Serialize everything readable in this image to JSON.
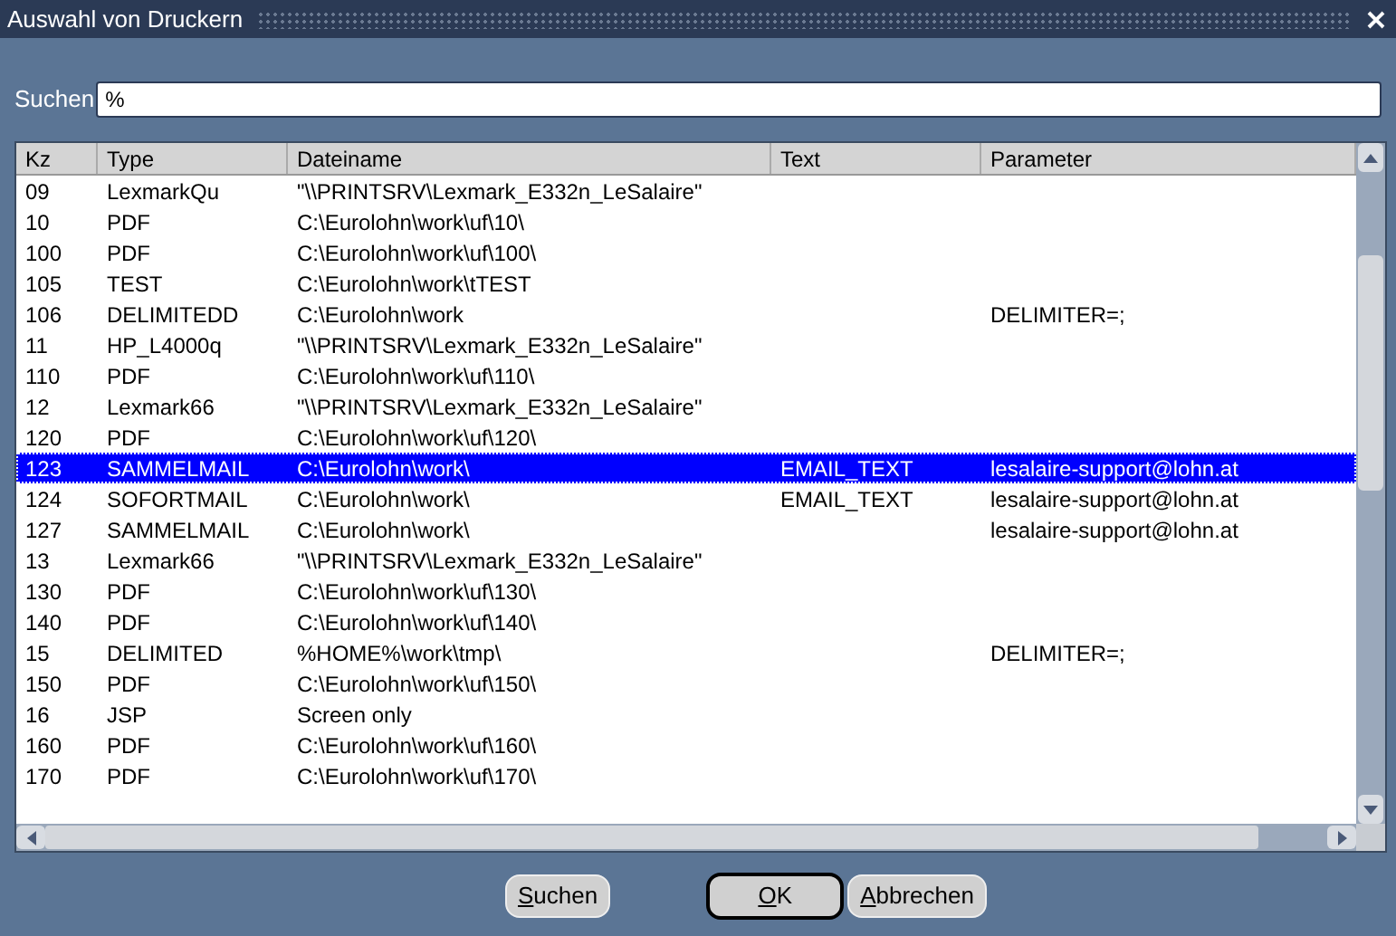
{
  "window": {
    "title": "Auswahl von Druckern"
  },
  "search": {
    "label": "Suchen",
    "value": "%"
  },
  "table": {
    "columns": [
      "Kz",
      "Type",
      "Dateiname",
      "Text",
      "Parameter"
    ],
    "rows": [
      {
        "cells": [
          "09",
          "LexmarkQu",
          "\"\\\\PRINTSRV\\Lexmark_E332n_LeSalaire\"",
          "",
          ""
        ],
        "selected": false
      },
      {
        "cells": [
          "10",
          "PDF",
          "C:\\Eurolohn\\work\\uf\\10\\",
          "",
          ""
        ],
        "selected": false
      },
      {
        "cells": [
          "100",
          "PDF",
          "C:\\Eurolohn\\work\\uf\\100\\",
          "",
          ""
        ],
        "selected": false
      },
      {
        "cells": [
          "105",
          "TEST",
          "C:\\Eurolohn\\work\\tTEST",
          "",
          ""
        ],
        "selected": false
      },
      {
        "cells": [
          "106",
          "DELIMITEDD",
          "C:\\Eurolohn\\work",
          "",
          "DELIMITER=;"
        ],
        "selected": false
      },
      {
        "cells": [
          "11",
          "HP_L4000q",
          "\"\\\\PRINTSRV\\Lexmark_E332n_LeSalaire\"",
          "",
          ""
        ],
        "selected": false
      },
      {
        "cells": [
          "110",
          "PDF",
          "C:\\Eurolohn\\work\\uf\\110\\",
          "",
          ""
        ],
        "selected": false
      },
      {
        "cells": [
          "12",
          "Lexmark66",
          "\"\\\\PRINTSRV\\Lexmark_E332n_LeSalaire\"",
          "",
          ""
        ],
        "selected": false
      },
      {
        "cells": [
          "120",
          "PDF",
          "C:\\Eurolohn\\work\\uf\\120\\",
          "",
          ""
        ],
        "selected": false
      },
      {
        "cells": [
          "123",
          "SAMMELMAIL",
          "C:\\Eurolohn\\work\\",
          "EMAIL_TEXT",
          "lesalaire-support@lohn.at"
        ],
        "selected": true
      },
      {
        "cells": [
          "124",
          "SOFORTMAIL",
          "C:\\Eurolohn\\work\\",
          "EMAIL_TEXT",
          "lesalaire-support@lohn.at"
        ],
        "selected": false
      },
      {
        "cells": [
          "127",
          "SAMMELMAIL",
          "C:\\Eurolohn\\work\\",
          "",
          "lesalaire-support@lohn.at"
        ],
        "selected": false
      },
      {
        "cells": [
          "13",
          "Lexmark66",
          "\"\\\\PRINTSRV\\Lexmark_E332n_LeSalaire\"",
          "",
          ""
        ],
        "selected": false
      },
      {
        "cells": [
          "130",
          "PDF",
          "C:\\Eurolohn\\work\\uf\\130\\",
          "",
          ""
        ],
        "selected": false
      },
      {
        "cells": [
          "140",
          "PDF",
          "C:\\Eurolohn\\work\\uf\\140\\",
          "",
          ""
        ],
        "selected": false
      },
      {
        "cells": [
          "15",
          "DELIMITED",
          "%HOME%\\work\\tmp\\",
          "",
          "DELIMITER=;"
        ],
        "selected": false
      },
      {
        "cells": [
          "150",
          "PDF",
          "C:\\Eurolohn\\work\\uf\\150\\",
          "",
          ""
        ],
        "selected": false
      },
      {
        "cells": [
          "16",
          "JSP",
          "Screen only",
          "",
          ""
        ],
        "selected": false
      },
      {
        "cells": [
          "160",
          "PDF",
          "C:\\Eurolohn\\work\\uf\\160\\",
          "",
          ""
        ],
        "selected": false
      },
      {
        "cells": [
          "170",
          "PDF",
          "C:\\Eurolohn\\work\\uf\\170\\",
          "",
          ""
        ],
        "selected": false
      }
    ]
  },
  "buttons": [
    {
      "label": "Suchen",
      "kind": "normal"
    },
    {
      "label": "OK",
      "kind": "default"
    },
    {
      "label": "Abbrechen",
      "kind": "normal"
    }
  ]
}
